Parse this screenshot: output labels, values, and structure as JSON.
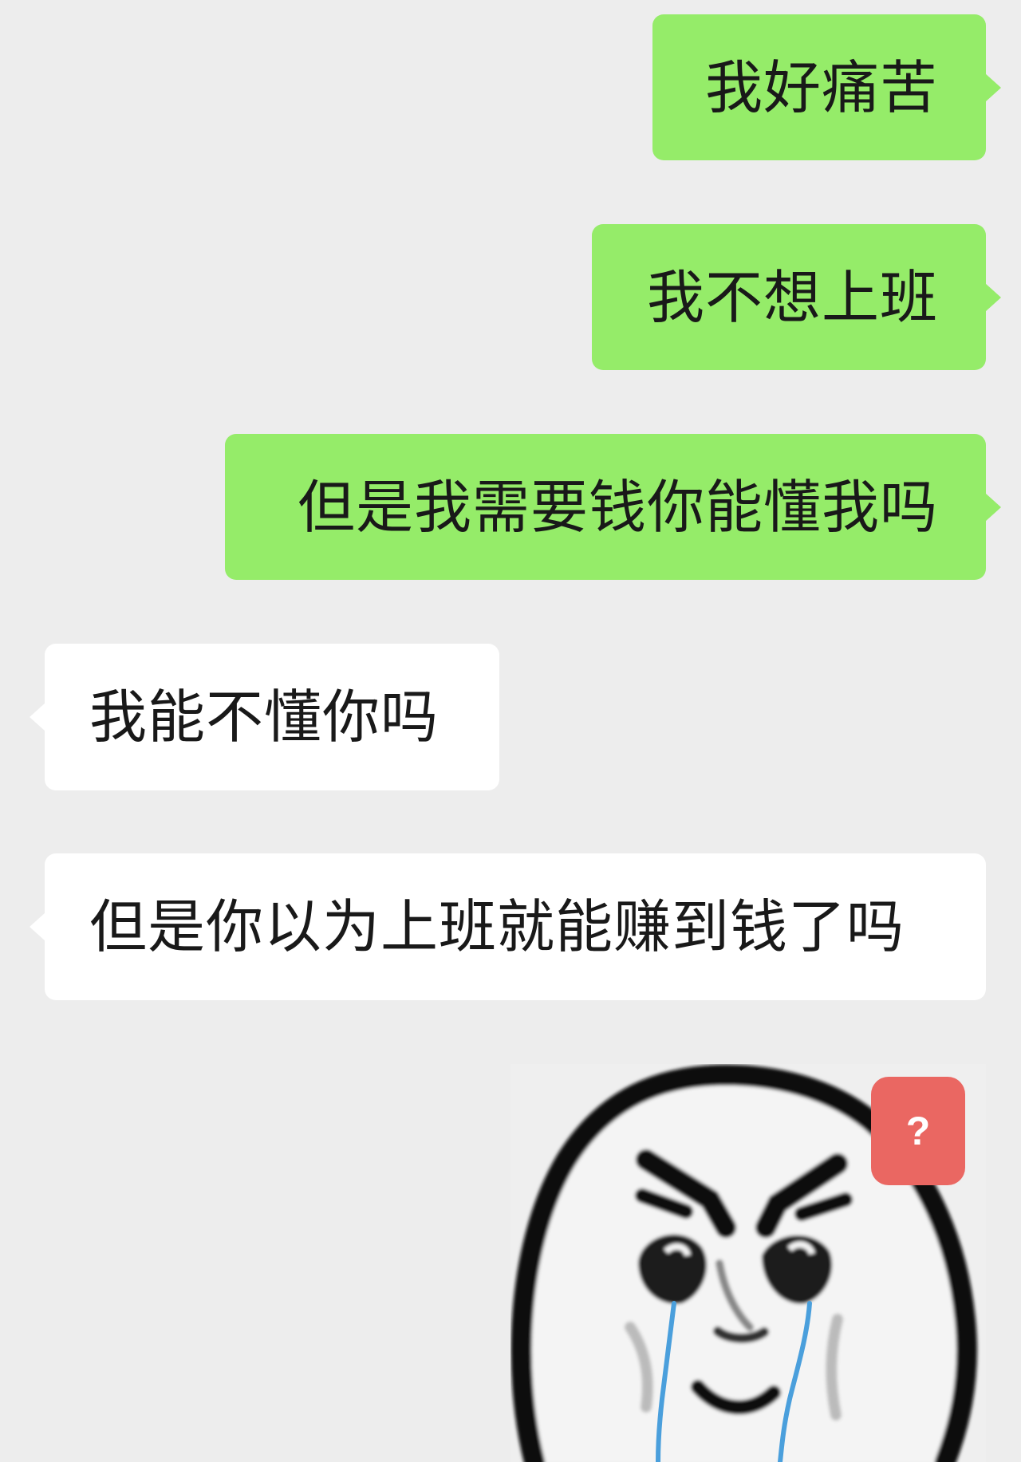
{
  "messages": [
    {
      "side": "sent",
      "text": "我好痛苦"
    },
    {
      "side": "sent",
      "text": "我不想上班"
    },
    {
      "side": "sent",
      "text": "但是我需要钱你能懂我吗"
    },
    {
      "side": "received",
      "text": "我能不懂你吗"
    },
    {
      "side": "received",
      "text": "但是你以为上班就能赚到钱了吗"
    }
  ],
  "sticker": {
    "badge": "?",
    "icon": "crying-face-meme"
  },
  "colors": {
    "background": "#ededed",
    "sent_bubble": "#95ec69",
    "received_bubble": "#ffffff",
    "badge": "#ea6762",
    "tears": "#4a9fdc"
  }
}
